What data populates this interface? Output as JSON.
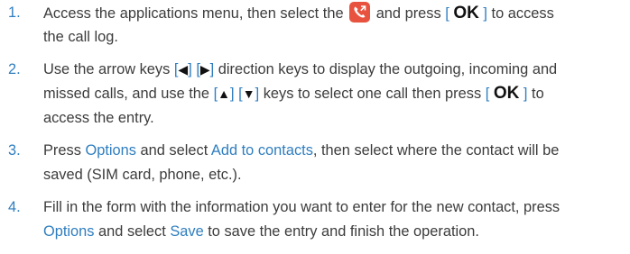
{
  "steps": [
    {
      "number": "1.",
      "line1_a": "Access the applications menu, then select the",
      "icon": "call-log-icon",
      "line1_b": "and press",
      "ok_key": "OK",
      "line1_c": "to access",
      "line2": "the call log."
    },
    {
      "number": "2.",
      "line1_a": "Use the arrow keys",
      "left_key": "◀",
      "right_key": "▶",
      "line1_b": "direction keys to display the outgoing, incoming and",
      "line2_a": "missed calls, and use the",
      "up_key": "▲",
      "down_key": "▼",
      "line2_b": "keys to select one call then press",
      "ok_key": "OK",
      "line2_c": "to",
      "line3": "access the entry."
    },
    {
      "number": "3.",
      "line1_a": "Press",
      "options_link": "Options",
      "line1_b": "and select",
      "add_link": "Add to contacts",
      "line1_c": ", then select where the contact will be",
      "line2": "saved (SIM card, phone, etc.)."
    },
    {
      "number": "4.",
      "line1": "Fill in the form with the information you want to enter for the new contact, press",
      "options_link": "Options",
      "line2_a": "and select",
      "save_link": "Save",
      "line2_b": "to save the entry and finish the operation."
    }
  ],
  "colors": {
    "accent": "#2f7ebf",
    "text": "#3c3c3c",
    "key": "#111111",
    "icon_bg": "#e8533f"
  }
}
